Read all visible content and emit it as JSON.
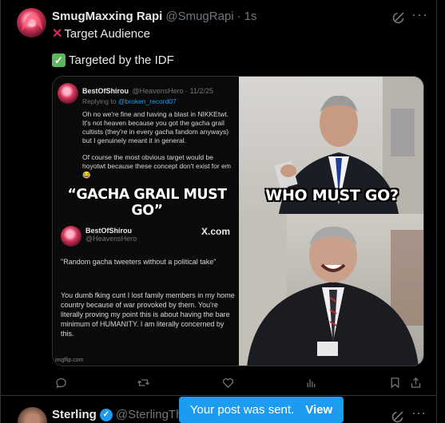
{
  "post": {
    "author_name": "SmugMaxxing Rapi",
    "handle": "@SmugRapi",
    "separator": "·",
    "time": "1s",
    "line1_icon": "cross-mark",
    "line1_text": "Target Audience",
    "line2_icon": "check-mark",
    "line2_text": "Targeted by the IDF",
    "more_label": "···",
    "meme": {
      "left_tweet": {
        "name": "BestOfShirou",
        "handle": "@HeavensHero · 11/2/25",
        "replying_prefix": "Replying to",
        "replying_handle": "@broken_record07",
        "text_p1": "Oh no we're fine and having a blast in NIKKEtwt. It's not heaven because you got the gacha grail cultists (they're in every gacha fandom anyways) but I genuinely meant it in general.",
        "text_p2": "Of course the most obvious target would be hoyotwt because these concept don't exist for em 😂"
      },
      "caption_left": "“GACHA GRAIL MUST GO”",
      "caption_right": "WHO MUST GO?",
      "left_tweet2": {
        "name": "BestOfShirou",
        "handle": "@HeavensHero",
        "brand": "X.com",
        "quote": "\"Random gacha tweeters without a political take\"",
        "text": "You dumb fking cunt I lost family members in my home country because of war provoked by them. You're literally proving my point this is about having the bare minimum of HUMANITY. I am literally concerned by this."
      },
      "watermark": "imgflip.com"
    }
  },
  "next_post": {
    "author_name": "Sterling",
    "handle": "@SterlingTheI"
  },
  "toast": {
    "message": "Your post was sent.",
    "action": "View"
  },
  "colors": {
    "accent": "#1d9bf0",
    "background": "#000000",
    "muted": "#71767b"
  }
}
